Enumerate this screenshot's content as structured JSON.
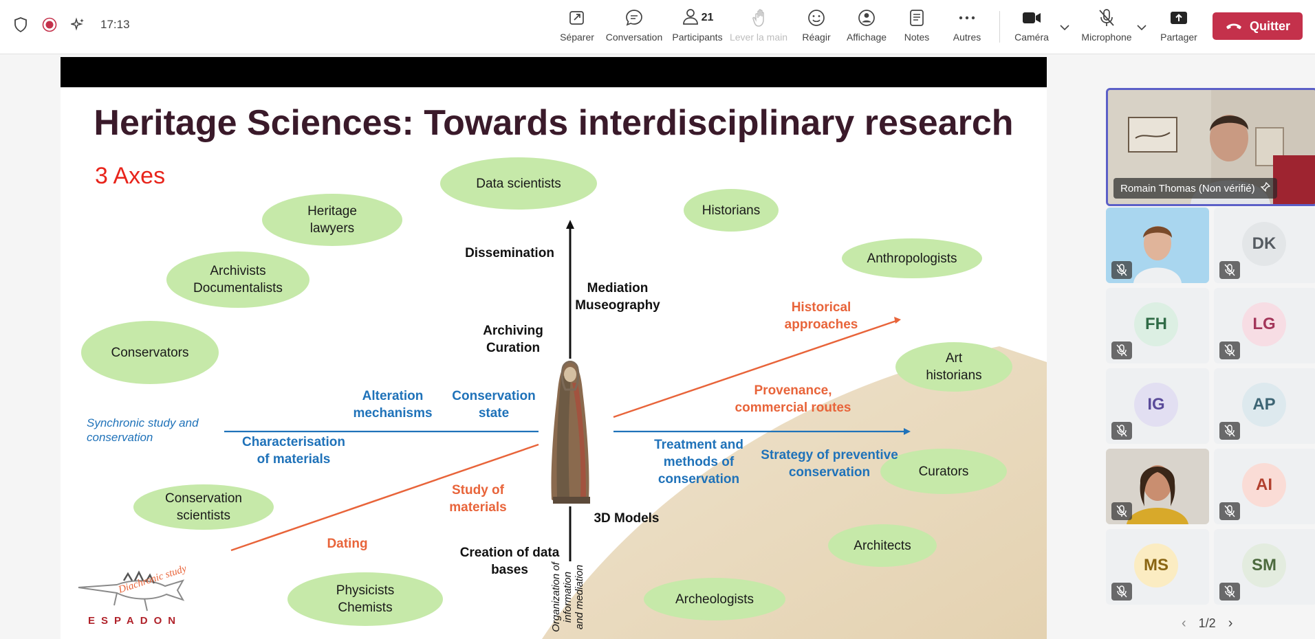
{
  "topbar": {
    "time": "17:13",
    "buttons": {
      "separer": "Séparer",
      "conversation": "Conversation",
      "participants": "Participants",
      "participants_count": "21",
      "lever_la_main": "Lever la main",
      "reagir": "Réagir",
      "affichage": "Affichage",
      "notes": "Notes",
      "autres": "Autres",
      "camera": "Caméra",
      "microphone": "Microphone",
      "partager": "Partager"
    },
    "quit_label": "Quitter",
    "quit_color": "#c4314b"
  },
  "slide": {
    "title": "Heritage Sciences: Towards interdisciplinary research",
    "axes_label": "3 Axes",
    "bubbles": {
      "data_scientists": "Data scientists",
      "heritage_lawyers_1": "Heritage",
      "heritage_lawyers_2": "lawyers",
      "historians": "Historians",
      "anthropologists": "Anthropologists",
      "archivists_1": "Archivists",
      "archivists_2": "Documentalists",
      "conservators": "Conservators",
      "art_historians_1": "Art",
      "art_historians_2": "historians",
      "conservation_scientists_1": "Conservation",
      "conservation_scientists_2": "scientists",
      "curators": "Curators",
      "architects": "Architects",
      "physicists_1": "Physicists",
      "physicists_2": "Chemists",
      "archeologists": "Archeologists"
    },
    "labels": {
      "dissemination": "Dissemination",
      "mediation_1": "Mediation",
      "mediation_2": "Museography",
      "archiving_1": "Archiving",
      "archiving_2": "Curation",
      "historical_1": "Historical",
      "historical_2": "approaches",
      "alteration_1": "Alteration",
      "alteration_2": "mechanisms",
      "conservation_state_1": "Conservation",
      "conservation_state_2": "state",
      "provenance_1": "Provenance,",
      "provenance_2": "commercial routes",
      "synchronic_1": "Synchronic study and",
      "synchronic_2": "conservation",
      "characterisation_1": "Characterisation",
      "characterisation_2": "of materials",
      "treatment_1": "Treatment and",
      "treatment_2": "methods of",
      "treatment_3": "conservation",
      "strategy_1": "Strategy of preventive",
      "strategy_2": "conservation",
      "study_materials_1": "Study of",
      "study_materials_2": "materials",
      "models_3d": "3D Models",
      "dating": "Dating",
      "creation_db_1": "Creation of data",
      "creation_db_2": "bases",
      "organization_1": "Organization of",
      "organization_2": "information",
      "organization_3": "and mediation",
      "diachronic": "Diachronic study",
      "espadon": "ESPADON"
    },
    "colors": {
      "bubble": "#c6e9a9",
      "blue_axis": "#1f72b9",
      "orange_axis": "#e8643a",
      "title": "#3a1a2a",
      "axes_red": "#e8241b"
    }
  },
  "participants": {
    "featured_name": "Romain Thomas (Non vérifié)",
    "tiles": [
      {
        "initials": "DK",
        "bg": "#e3e6e8",
        "fg": "#555b61"
      },
      {
        "initials": "FH",
        "bg": "#dcefe3",
        "fg": "#2f6b46"
      },
      {
        "initials": "LG",
        "bg": "#f7dde4",
        "fg": "#a3365a"
      },
      {
        "initials": "IG",
        "bg": "#e2dff2",
        "fg": "#5a4b9a"
      },
      {
        "initials": "AP",
        "bg": "#dde9ee",
        "fg": "#3d6574"
      },
      {
        "initials": "AI",
        "bg": "#fadcd6",
        "fg": "#b2402e"
      },
      {
        "initials": "MS",
        "bg": "#fbecc2",
        "fg": "#8a6512"
      },
      {
        "initials": "SM",
        "bg": "#e3ecdf",
        "fg": "#4c6a3e"
      }
    ],
    "page_indicator": "1/2"
  }
}
